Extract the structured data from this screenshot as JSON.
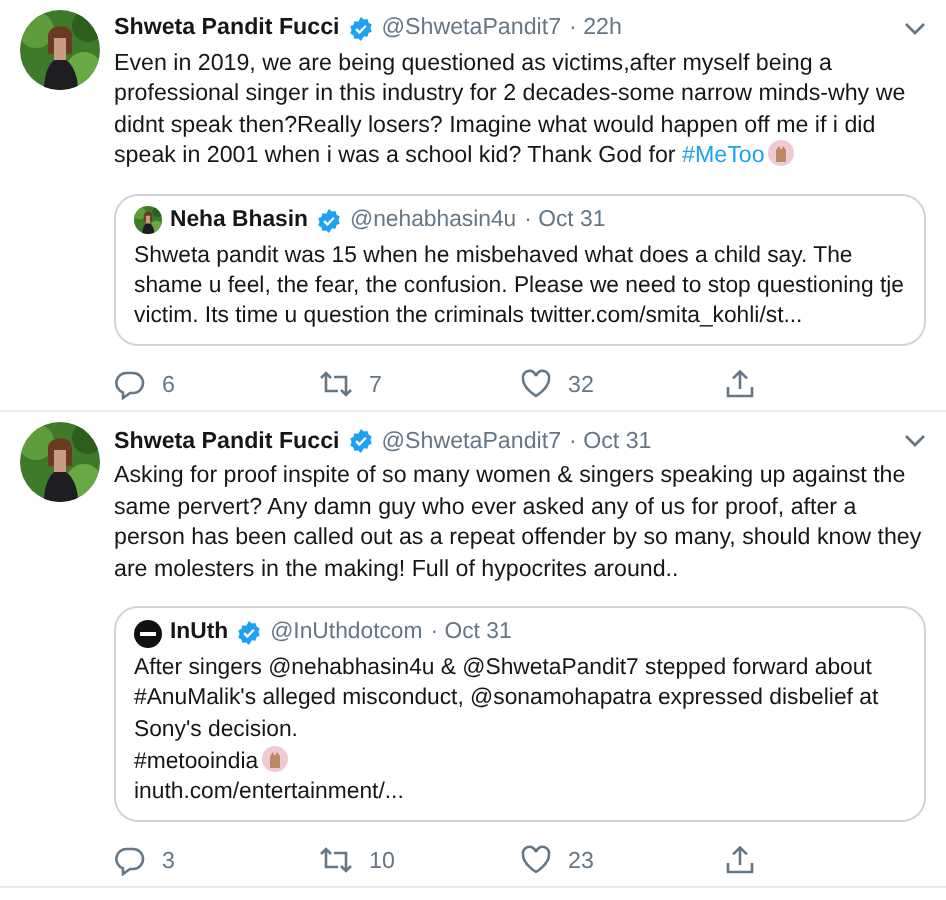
{
  "tweets": [
    {
      "author": "Shweta Pandit Fucci",
      "verified": true,
      "handle": "@ShwetaPandit7",
      "time": "· 22h",
      "body": "Even in 2019, we are being questioned as victims,after myself being a professional singer in this industry for 2 decades-some narrow minds-why we didnt speak then?Really losers? Imagine what would happen off me if i did speak in 2001 when i was a school kid? Thank God for ",
      "hashtag": "#MeToo",
      "quote": {
        "author": "Neha Bhasin",
        "verified": true,
        "handle": "@nehabhasin4u",
        "time": "· Oct 31",
        "lines": [
          {
            "text": "Shweta pandit was 15 when he misbehaved what does a child say. The shame u feel, the fear, the confusion. Please we need to stop questioning tje victim. Its time u question the criminals twitter.com/smita_kohli/st...",
            "emoji": false
          }
        ]
      },
      "replies": "6",
      "retweets": "7",
      "likes": "32"
    },
    {
      "author": "Shweta Pandit Fucci",
      "verified": true,
      "handle": "@ShwetaPandit7",
      "time": "· Oct 31",
      "body": "Asking for proof inspite of so many women & singers speaking up against the same pervert? Any damn guy who ever asked any of us for proof, after a person has been called out as a repeat offender by so many, should know they are molesters in the making! Full of hypocrites around..",
      "quote": {
        "kind": "logo",
        "author": "InUth",
        "verified": true,
        "handle": "@InUthdotcom",
        "time": "· Oct 31",
        "lines": [
          {
            "text": "After singers @nehabhasin4u & @ShwetaPandit7 stepped forward about #AnuMalik's alleged misconduct, @sonamohapatra expressed disbelief at Sony's decision.",
            "emoji": false
          },
          {
            "text": "#metooindia",
            "emoji": true
          },
          {
            "text": "inuth.com/entertainment/...",
            "emoji": false
          }
        ]
      },
      "replies": "3",
      "retweets": "10",
      "likes": "23"
    }
  ]
}
